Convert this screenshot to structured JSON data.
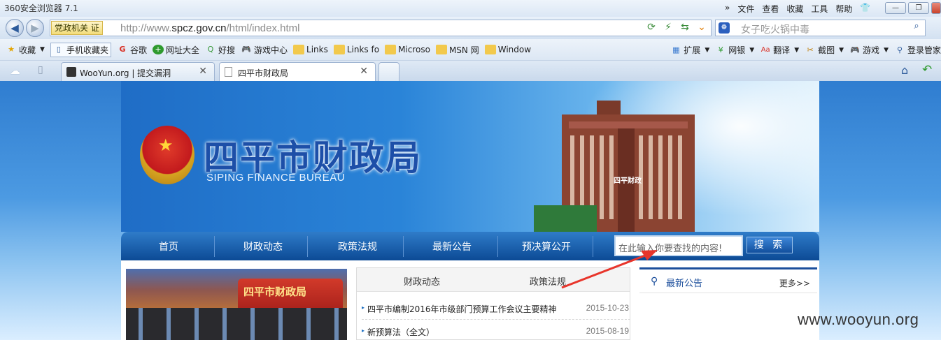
{
  "browser": {
    "title": "360安全浏览器 7.1",
    "menus": [
      "»",
      "文件",
      "查看",
      "收藏",
      "工具",
      "帮助"
    ],
    "win_buttons": [
      "—",
      "❐",
      "✕"
    ],
    "address": {
      "badge": "党政机关 证",
      "url_prefix": "http://www.",
      "url_domain": "spcz.gov.cn",
      "url_path": "/html/index.html"
    },
    "search": {
      "placeholder": "女子吃火锅中毒"
    }
  },
  "favorites": {
    "items": [
      {
        "label": "收藏",
        "icon": "star-icon"
      },
      {
        "label": "手机收藏夹",
        "icon": "phone-icon"
      },
      {
        "label": "谷歌",
        "icon": "google-icon"
      },
      {
        "label": "网址大全",
        "icon": "plus-icon"
      },
      {
        "label": "好搜",
        "icon": "search-icon"
      },
      {
        "label": "游戏中心",
        "icon": "gamepad-icon"
      },
      {
        "label": "Links",
        "icon": "folder-icon"
      },
      {
        "label": "Links fo",
        "icon": "folder-icon"
      },
      {
        "label": "Microso",
        "icon": "folder-icon"
      },
      {
        "label": "MSN 网",
        "icon": "folder-icon"
      },
      {
        "label": "Window",
        "icon": "folder-icon"
      }
    ],
    "right_items": [
      {
        "label": "扩展",
        "icon": "grid-icon"
      },
      {
        "label": "网银",
        "icon": "bank-icon"
      },
      {
        "label": "翻译",
        "icon": "translate-icon"
      },
      {
        "label": "截图",
        "icon": "scissors-icon"
      },
      {
        "label": "游戏",
        "icon": "gamepad-icon"
      },
      {
        "label": "登录管家",
        "icon": "key-icon"
      }
    ]
  },
  "tabs": [
    {
      "label": "WooYun.org | 提交漏洞",
      "active": false
    },
    {
      "label": "四平市财政局",
      "active": true
    }
  ],
  "site": {
    "title": "四平市财政局",
    "subtitle": "SIPING FINANCE BUREAU",
    "building_sign": "四平财政",
    "nav": [
      "首页",
      "财政动态",
      "政策法规",
      "最新公告",
      "预决算公开"
    ],
    "search_placeholder": "在此输入你要查找的内容!",
    "search_button": "搜 索",
    "photo_banner": "四平市财政局"
  },
  "news": {
    "tabs": [
      "财政动态",
      "政策法规"
    ],
    "rows": [
      {
        "title": "四平市编制2016年市级部门预算工作会议主要精神",
        "date": "2015-10-23"
      },
      {
        "title": "新预算法（全文）",
        "date": "2015-08-19"
      }
    ]
  },
  "notice": {
    "title": "最新公告",
    "more": "更多>>"
  },
  "watermark": "www.wooyun.org"
}
